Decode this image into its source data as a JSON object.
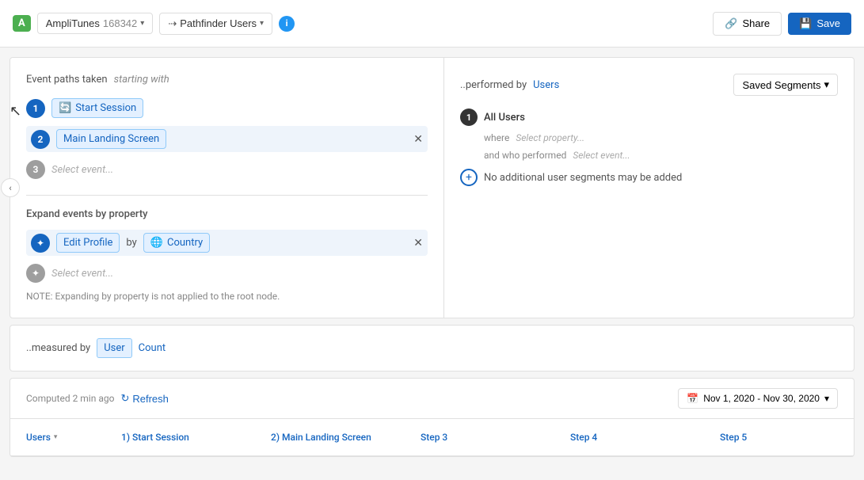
{
  "app": {
    "name": "AmpliTunes",
    "id": "168342",
    "dropdown_chevron": "▾"
  },
  "pathfinder": {
    "label": "Pathfinder Users",
    "icon": "pathfinder-icon"
  },
  "nav": {
    "share_label": "Share",
    "save_label": "Save"
  },
  "left_panel": {
    "section_title": "Event paths taken",
    "starting_with": "starting with",
    "events": [
      {
        "number": "1",
        "label": "Start Session",
        "icon": "🔄",
        "removable": false
      },
      {
        "number": "2",
        "label": "Main Landing Screen",
        "icon": "",
        "removable": true
      }
    ],
    "event_placeholder": "Select event...",
    "expand_title": "Expand events by property",
    "expand_events": [
      {
        "event": "Edit Profile",
        "by": "by",
        "property": "Country",
        "property_icon": "🌐",
        "removable": true
      }
    ],
    "expand_placeholder": "Select event...",
    "note": "NOTE: Expanding by property is not applied to the root node."
  },
  "right_panel": {
    "performed_label": "..performed by",
    "users_label": "Users",
    "saved_segments_label": "Saved Segments",
    "segment_number": "1",
    "segment_name": "All Users",
    "where_label": "where",
    "select_property_placeholder": "Select property...",
    "and_who_label": "and who performed",
    "select_event_placeholder": "Select event...",
    "no_segments_text": "No additional user segments may be added"
  },
  "measured_panel": {
    "label": "..measured by",
    "user_label": "User",
    "count_label": "Count"
  },
  "bottom_panel": {
    "computed_text": "Computed 2 min ago",
    "refresh_label": "Refresh",
    "date_range": "Nov 1, 2020 - Nov 30, 2020",
    "columns": [
      {
        "label": "Users"
      },
      {
        "label": "1) Start Session"
      },
      {
        "label": "2) Main Landing Screen"
      },
      {
        "label": "Step 3"
      },
      {
        "label": "Step 4"
      },
      {
        "label": "Step 5"
      }
    ]
  }
}
